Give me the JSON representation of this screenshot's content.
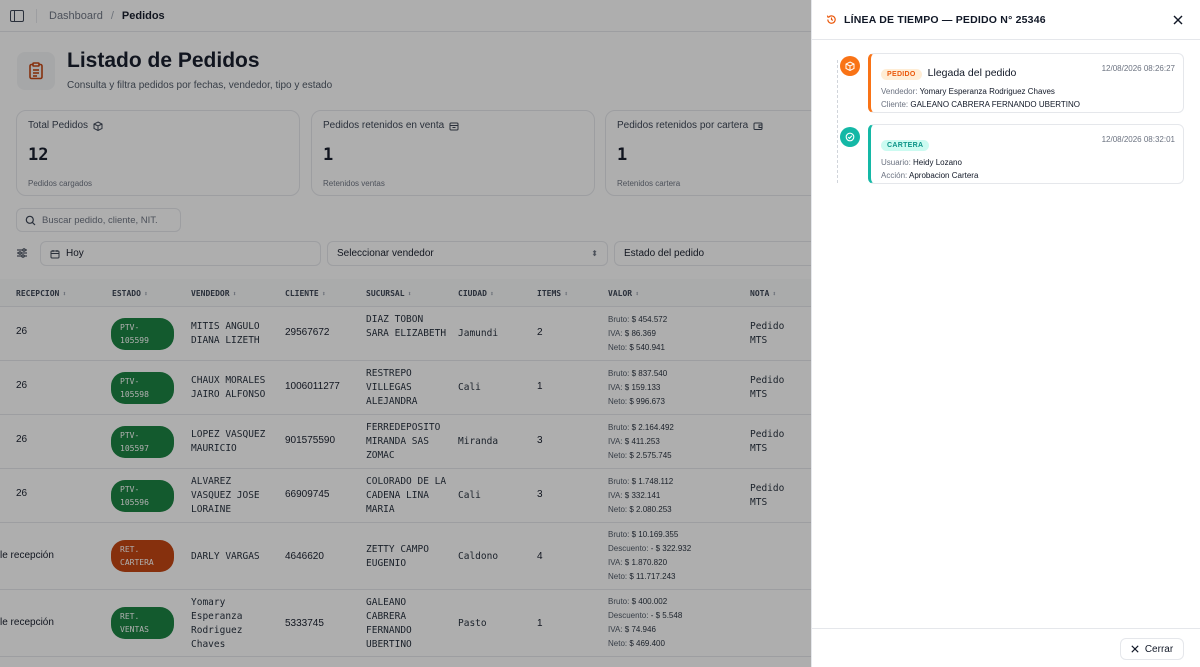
{
  "topbar": {
    "breadcrumb_root": "Dashboard",
    "breadcrumb_sep": "/",
    "breadcrumb_current": "Pedidos"
  },
  "header": {
    "title": "Listado de Pedidos",
    "subtitle": "Consulta y filtra pedidos por fechas, vendedor, tipo y estado",
    "icon": "clipboard-icon"
  },
  "cards": [
    {
      "title": "Total Pedidos",
      "icon": "box-icon",
      "value": "12",
      "footer": "Pedidos cargados"
    },
    {
      "title": "Pedidos retenidos en venta",
      "icon": "calendar-icon",
      "value": "1",
      "footer": "Retenidos ventas"
    },
    {
      "title": "Pedidos retenidos por cartera",
      "icon": "wallet-icon",
      "value": "1",
      "footer": "Retenidos cartera"
    }
  ],
  "search": {
    "placeholder": "Buscar pedido, cliente, NIT."
  },
  "filters": {
    "date": "Hoy",
    "vendor": "Seleccionar vendedor",
    "status": "Estado del pedido"
  },
  "table": {
    "headers": [
      "RECEPCION",
      "ESTADO",
      "VENDEDOR",
      "CLIENTE",
      "SUCURSAL",
      "CIUDAD",
      "ITEMS",
      "VALOR",
      "NOTA"
    ],
    "rows": [
      {
        "recepcion": "26",
        "estado": "PTV-105599",
        "estado_color": "green",
        "vendedor": "MITIS ANGULO DIANA LIZETH",
        "cliente": "29567672",
        "sucursal": "DIAZ TOBON SARA ELIZABETH",
        "ciudad": "Jamundi",
        "items": "2",
        "valor": [
          {
            "k": "Bruto:",
            "v": "$ 454.572"
          },
          {
            "k": "IVA:",
            "v": "$ 86.369"
          },
          {
            "k": "Neto:",
            "v": "$ 540.941"
          }
        ],
        "nota": "Pedido MTS"
      },
      {
        "recepcion": "26",
        "estado": "PTV-105598",
        "estado_color": "green",
        "vendedor": "CHAUX MORALES JAIRO ALFONSO",
        "cliente": "1006011277",
        "sucursal": "RESTREPO VILLEGAS ALEJANDRA",
        "ciudad": "Cali",
        "items": "1",
        "valor": [
          {
            "k": "Bruto:",
            "v": "$ 837.540"
          },
          {
            "k": "IVA:",
            "v": "$ 159.133"
          },
          {
            "k": "Neto:",
            "v": "$ 996.673"
          }
        ],
        "nota": "Pedido MTS"
      },
      {
        "recepcion": "26",
        "estado": "PTV-105597",
        "estado_color": "green",
        "vendedor": "LOPEZ VASQUEZ MAURICIO",
        "cliente": "901575590",
        "sucursal": "FERREDEPOSITO MIRANDA SAS ZOMAC",
        "ciudad": "Miranda",
        "items": "3",
        "valor": [
          {
            "k": "Bruto:",
            "v": "$ 2.164.492"
          },
          {
            "k": "IVA:",
            "v": "$ 411.253"
          },
          {
            "k": "Neto:",
            "v": "$ 2.575.745"
          }
        ],
        "nota": "Pedido MTS"
      },
      {
        "recepcion": "26",
        "estado": "PTV-105596",
        "estado_color": "green",
        "vendedor": "ALVAREZ VASQUEZ JOSE LORAINE",
        "cliente": "66909745",
        "sucursal": "COLORADO DE LA CADENA LINA MARIA",
        "ciudad": "Cali",
        "items": "3",
        "valor": [
          {
            "k": "Bruto:",
            "v": "$ 1.748.112"
          },
          {
            "k": "IVA:",
            "v": "$ 332.141"
          },
          {
            "k": "Neto:",
            "v": "$ 2.080.253"
          }
        ],
        "nota": "Pedido MTS"
      },
      {
        "recepcion": "le recepción",
        "estado": "RET. CARTERA",
        "estado_color": "orange",
        "vendedor": "DARLY VARGAS",
        "cliente": "4646620",
        "sucursal": "ZETTY CAMPO EUGENIO",
        "ciudad": "Caldono",
        "items": "4",
        "valor": [
          {
            "k": "Bruto:",
            "v": "$ 10.169.355"
          },
          {
            "k": "Descuento:",
            "v": "- $ 322.932"
          },
          {
            "k": "IVA:",
            "v": "$ 1.870.820"
          },
          {
            "k": "Neto:",
            "v": "$ 11.717.243"
          }
        ],
        "nota": ""
      },
      {
        "recepcion": "le recepción",
        "estado": "RET. VENTAS",
        "estado_color": "green",
        "vendedor": "Yomary Esperanza Rodriguez Chaves",
        "cliente": "5333745",
        "sucursal": "GALEANO CABRERA FERNANDO UBERTINO",
        "ciudad": "Pasto",
        "items": "1",
        "valor": [
          {
            "k": "Bruto:",
            "v": "$ 400.002"
          },
          {
            "k": "Descuento:",
            "v": "- $ 5.548"
          },
          {
            "k": "IVA:",
            "v": "$ 74.946"
          },
          {
            "k": "Neto:",
            "v": "$ 469.400"
          }
        ],
        "nota": ""
      }
    ]
  },
  "drawer": {
    "title": "LÍNEA DE TIEMPO — PEDIDO N° 25346",
    "events": [
      {
        "tag": "PEDIDO",
        "title": "Llegada del pedido",
        "date": "12/08/2026 08:26:27",
        "lines": [
          {
            "k": "Vendedor:",
            "v": "Yomary Esperanza Rodriguez Chaves"
          },
          {
            "k": "Cliente:",
            "v": "GALEANO CABRERA FERNANDO UBERTINO"
          }
        ]
      },
      {
        "tag": "CARTERA",
        "title": "",
        "date": "12/08/2026 08:32:01",
        "lines": [
          {
            "k": "Usuario:",
            "v": "Heidy Lozano"
          },
          {
            "k": "Acción:",
            "v": "Aprobacion Cartera"
          }
        ]
      }
    ],
    "close_label": "Cerrar"
  },
  "colors": {
    "accent_orange": "#f97316",
    "accent_teal": "#14b8a6",
    "badge_green": "#15803d",
    "badge_orange": "#c2410c"
  }
}
